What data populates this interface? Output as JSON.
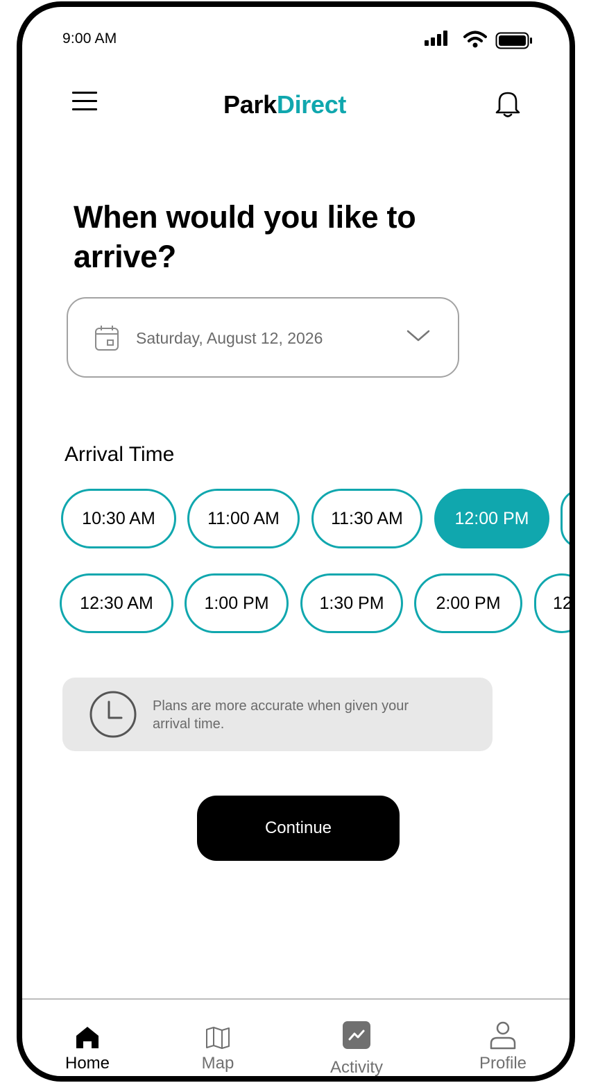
{
  "status_bar": {
    "time": "9:00 AM"
  },
  "header": {
    "brand_primary": "Park",
    "brand_accent": "Direct",
    "accent_color": "#10a7ae"
  },
  "main": {
    "title": "When would you like to arrive?",
    "date_picker": {
      "value": "Saturday, August 12, 2026"
    },
    "arrival_label": "Arrival Time",
    "time_slots_row1": [
      "10:30 AM",
      "11:00 AM",
      "11:30 AM",
      "12:00 PM",
      ""
    ],
    "time_slots_row2": [
      "12:30 AM",
      "1:00 PM",
      "1:30 PM",
      "2:00 PM",
      "12"
    ],
    "selected_slot": "12:00 PM",
    "hint": "Plans are more accurate when given your arrival time.",
    "continue_label": "Continue"
  },
  "nav": {
    "items": [
      {
        "label": "Home",
        "icon": "home-icon",
        "active": true
      },
      {
        "label": "Map",
        "icon": "map-icon",
        "active": false
      },
      {
        "label": "Activity",
        "icon": "activity-icon",
        "active": false
      },
      {
        "label": "Profile",
        "icon": "profile-icon",
        "active": false
      }
    ]
  }
}
